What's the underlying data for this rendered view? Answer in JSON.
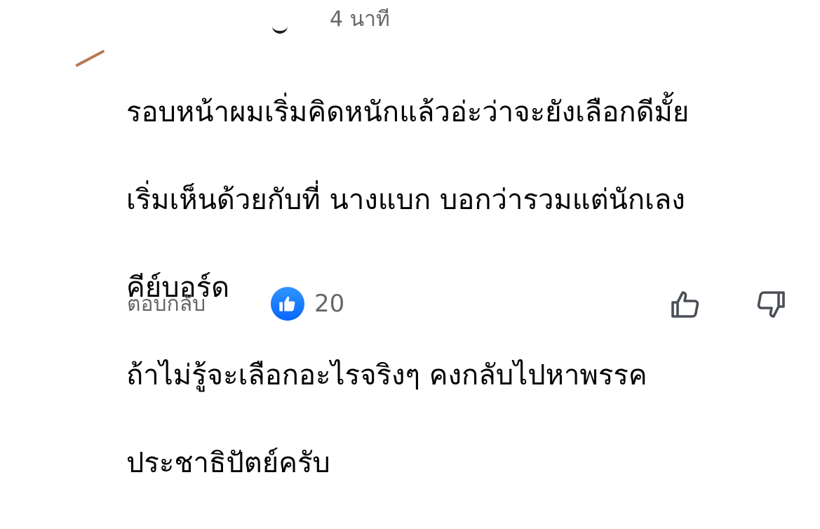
{
  "comment": {
    "timestamp": "4 นาที",
    "lines": [
      "รอบหน้าผมเริ่มคิดหนักแล้วอ่ะว่าจะยังเลือกดีมั้ย",
      "เริ่มเห็นด้วยกับที่ นางแบก บอกว่ารวมแต่นักเลง",
      "คีย์บอร์ด",
      "ถ้าไม่รู้จะเลือกอะไรจริงๆ คงกลับไปหาพรรค",
      "ประชาธิปัตย์ครับ"
    ]
  },
  "actions": {
    "reply_label": "ตอบกลับ",
    "reaction_icon": "like-thumbs-up-icon",
    "reaction_count": "20",
    "upvote_icon": "thumbs-up-outline-icon",
    "downvote_icon": "thumbs-down-outline-icon"
  },
  "colors": {
    "text": "#050505",
    "secondary": "#65676b",
    "like_blue": "#0866ff",
    "icon": "#4b4f56"
  }
}
